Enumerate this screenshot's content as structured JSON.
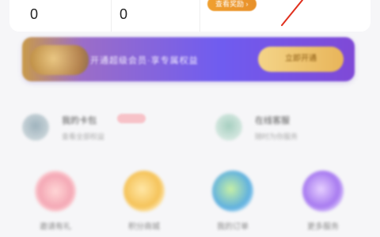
{
  "stats": {
    "items": [
      {
        "value": "0"
      },
      {
        "value": "0"
      }
    ],
    "view_button_label": "查看奖励 ›"
  },
  "promo": {
    "text": "开通超级会员·享专属权益",
    "button_label": "立即开通",
    "accent_color": "#6f5cf0"
  },
  "services": [
    {
      "title": "我的卡包",
      "subtitle": "查看全部权益",
      "icon": "wallet-icon"
    },
    {
      "title": "在线客服",
      "subtitle": "随时为你服务",
      "icon": "headset-icon"
    }
  ],
  "grid": [
    {
      "label": "邀请有礼",
      "icon": "gift-icon"
    },
    {
      "label": "积分商城",
      "icon": "coin-icon"
    },
    {
      "label": "我的订单",
      "icon": "order-icon"
    },
    {
      "label": "更多服务",
      "icon": "more-icon"
    }
  ]
}
